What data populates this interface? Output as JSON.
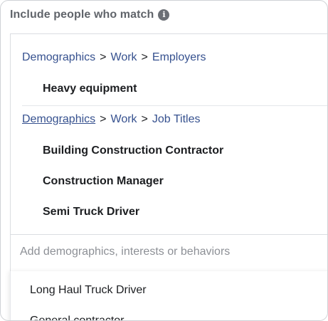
{
  "header": {
    "title": "Include people who match",
    "info_icon": "i"
  },
  "groups": [
    {
      "breadcrumb": [
        "Demographics",
        "Work",
        "Employers"
      ],
      "separator": ">",
      "items": [
        "Heavy equipment"
      ]
    },
    {
      "breadcrumb": [
        "Demographics",
        "Work",
        "Job Titles"
      ],
      "separator": ">",
      "items": [
        "Building Construction Contractor",
        "Construction Manager",
        "Semi Truck Driver"
      ]
    }
  ],
  "search": {
    "placeholder": "Add demographics, interests or behaviors",
    "value": ""
  },
  "suggestions": [
    "Long Haul Truck Driver",
    "General contractor"
  ],
  "colors": {
    "link": "#36518f",
    "text": "#1c1e21",
    "muted": "#8d9096",
    "border": "#dadde1"
  }
}
